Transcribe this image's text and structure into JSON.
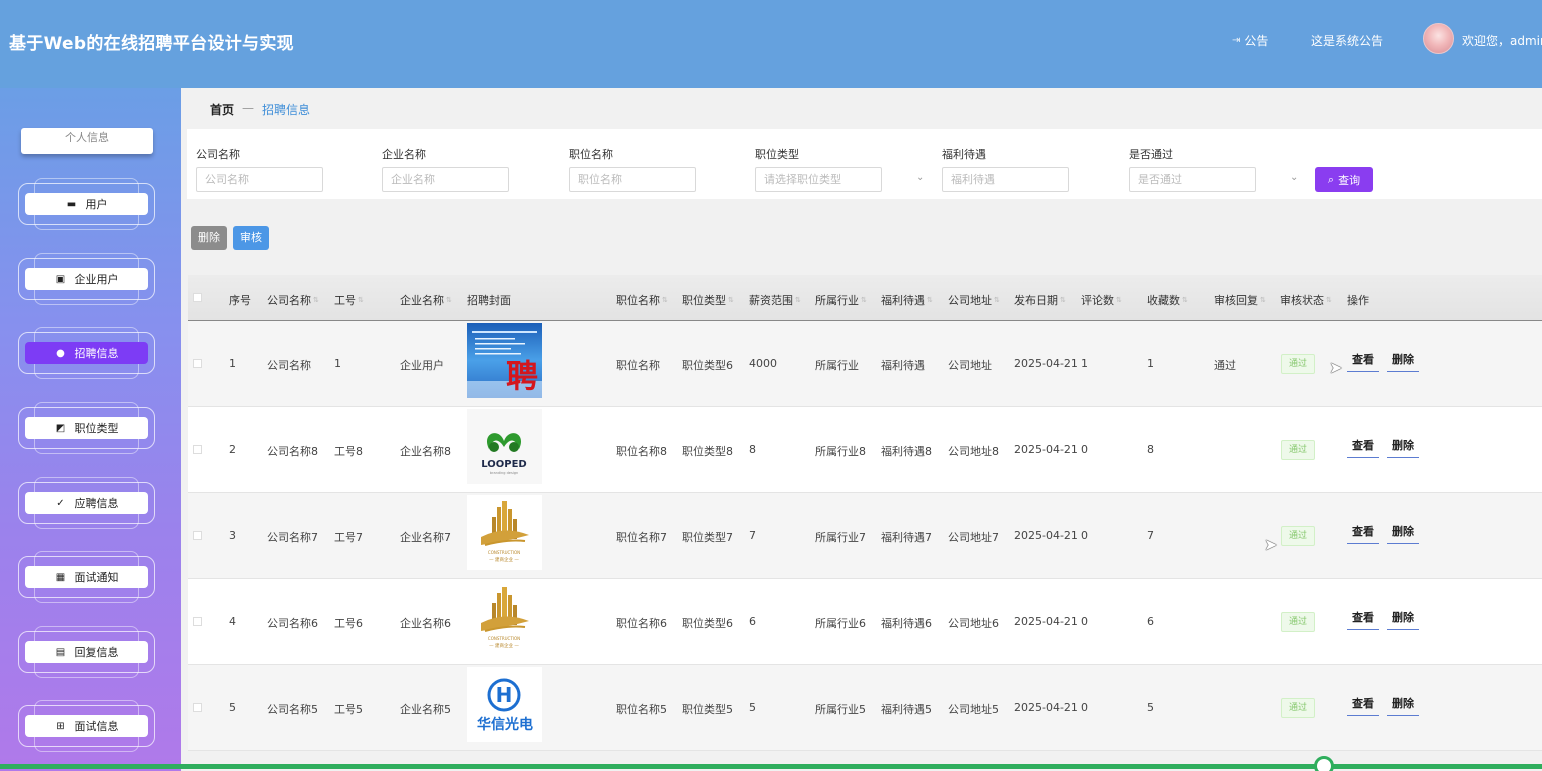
{
  "header": {
    "title": "基于Web的在线招聘平台设计与实现",
    "notice_label": "公告",
    "system_notice": "这是系统公告",
    "welcome": "欢迎您，admin"
  },
  "sidebar": {
    "profile": "个人信息",
    "items": [
      {
        "label": "用户",
        "icon": "user-card-icon"
      },
      {
        "label": "企业用户",
        "icon": "briefcase-icon"
      },
      {
        "label": "招聘信息",
        "icon": "person-icon",
        "active": true
      },
      {
        "label": "职位类型",
        "icon": "chart-icon"
      },
      {
        "label": "应聘信息",
        "icon": "clipboard-check-icon"
      },
      {
        "label": "面试通知",
        "icon": "grid-icon"
      },
      {
        "label": "回复信息",
        "icon": "clipboard-icon"
      },
      {
        "label": "面试信息",
        "icon": "squares-icon"
      }
    ]
  },
  "breadcrumb": {
    "home": "首页",
    "sep": "—",
    "current": "招聘信息"
  },
  "search": {
    "fields": [
      {
        "label": "公司名称",
        "placeholder": "公司名称"
      },
      {
        "label": "企业名称",
        "placeholder": "企业名称"
      },
      {
        "label": "职位名称",
        "placeholder": "职位名称"
      },
      {
        "label": "职位类型",
        "placeholder": "请选择职位类型"
      },
      {
        "label": "福利待遇",
        "placeholder": "福利待遇"
      },
      {
        "label": "是否通过",
        "placeholder": "是否通过"
      }
    ],
    "button": "查询"
  },
  "actions": {
    "delete": "删除",
    "audit": "审核"
  },
  "table": {
    "columns": [
      "序号",
      "公司名称",
      "工号",
      "企业名称",
      "招聘封面",
      "职位名称",
      "职位类型",
      "薪资范围",
      "所属行业",
      "福利待遇",
      "公司地址",
      "发布日期",
      "评论数",
      "收藏数",
      "审核回复",
      "审核状态",
      "操作"
    ],
    "rows": [
      {
        "no": "1",
        "company": "公司名称",
        "emp_no": "1",
        "enterprise": "企业用户",
        "cover": "poster",
        "position": "职位名称",
        "type": "职位类型6",
        "salary": "4000",
        "industry": "所属行业",
        "welfare": "福利待遇",
        "address": "公司地址",
        "date": "2025-04-21",
        "comments": "1",
        "favorites": "1",
        "reply": "通过",
        "status": "通过"
      },
      {
        "no": "2",
        "company": "公司名称8",
        "emp_no": "工号8",
        "enterprise": "企业名称8",
        "cover": "looped",
        "position": "职位名称8",
        "type": "职位类型8",
        "salary": "8",
        "industry": "所属行业8",
        "welfare": "福利待遇8",
        "address": "公司地址8",
        "date": "2025-04-21",
        "comments": "0",
        "favorites": "8",
        "reply": "",
        "status": "通过"
      },
      {
        "no": "3",
        "company": "公司名称7",
        "emp_no": "工号7",
        "enterprise": "企业名称7",
        "cover": "construction",
        "position": "职位名称7",
        "type": "职位类型7",
        "salary": "7",
        "industry": "所属行业7",
        "welfare": "福利待遇7",
        "address": "公司地址7",
        "date": "2025-04-21",
        "comments": "0",
        "favorites": "7",
        "reply": "",
        "status": "通过"
      },
      {
        "no": "4",
        "company": "公司名称6",
        "emp_no": "工号6",
        "enterprise": "企业名称6",
        "cover": "construction",
        "position": "职位名称6",
        "type": "职位类型6",
        "salary": "6",
        "industry": "所属行业6",
        "welfare": "福利待遇6",
        "address": "公司地址6",
        "date": "2025-04-21",
        "comments": "0",
        "favorites": "6",
        "reply": "",
        "status": "通过"
      },
      {
        "no": "5",
        "company": "公司名称5",
        "emp_no": "工号5",
        "enterprise": "企业名称5",
        "cover": "huaxin",
        "position": "职位名称5",
        "type": "职位类型5",
        "salary": "5",
        "industry": "所属行业5",
        "welfare": "福利待遇5",
        "address": "公司地址5",
        "date": "2025-04-21",
        "comments": "0",
        "favorites": "5",
        "reply": "",
        "status": "通过"
      }
    ],
    "row_actions": {
      "view": "查看",
      "delete": "删除"
    }
  },
  "logos": {
    "poster_char": "聘",
    "looped_text": "LOOPED",
    "looped_sub": "branding design",
    "construction_text": "CONSTRUCTION",
    "construction_sub": "— 建商企业 —",
    "huaxin_letter": "H",
    "huaxin_text": "华信光电"
  }
}
